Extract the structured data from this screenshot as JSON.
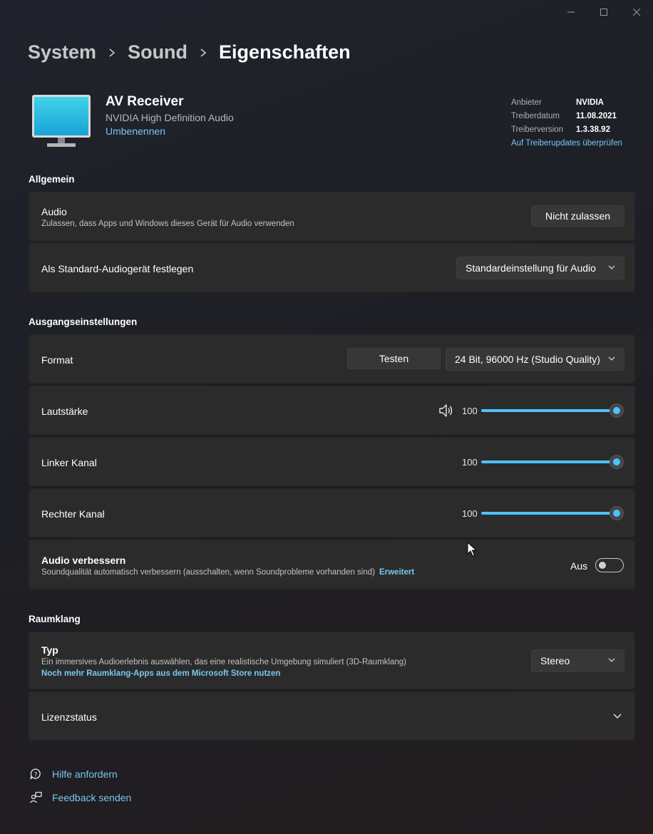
{
  "breadcrumb": {
    "items": [
      "System",
      "Sound"
    ],
    "current": "Eigenschaften"
  },
  "device": {
    "name": "AV Receiver",
    "description": "NVIDIA High Definition Audio",
    "rename_link": "Umbenennen",
    "icon": "monitor-icon"
  },
  "driver": {
    "provider_label": "Anbieter",
    "provider_value": "NVIDIA",
    "date_label": "Treiberdatum",
    "date_value": "11.08.2021",
    "version_label": "Treiberversion",
    "version_value": "1.3.38.92",
    "update_link": "Auf Treiberupdates überprüfen"
  },
  "sections": {
    "general": "Allgemein",
    "output": "Ausgangseinstellungen",
    "spatial": "Raumklang"
  },
  "audio": {
    "title": "Audio",
    "subtitle": "Zulassen, dass Apps und Windows dieses Gerät für Audio verwenden",
    "button": "Nicht zulassen"
  },
  "default_device": {
    "title": "Als Standard-Audiogerät festlegen",
    "dropdown": "Standardeinstellung für Audio"
  },
  "format": {
    "title": "Format",
    "test_button": "Testen",
    "dropdown": "24 Bit, 96000 Hz (Studio Quality)"
  },
  "volume": {
    "title": "Lautstärke",
    "value": "100",
    "level": 1.0,
    "icon": "speaker-icon"
  },
  "left_channel": {
    "title": "Linker Kanal",
    "value": "100",
    "level": 1.0
  },
  "right_channel": {
    "title": "Rechter Kanal",
    "value": "100",
    "level": 1.0
  },
  "enhance": {
    "title": "Audio verbessern",
    "subtitle": "Soundqualität automatisch verbessern (ausschalten, wenn Soundprobleme vorhanden sind)",
    "link": "Erweitert",
    "state_label": "Aus",
    "state": false
  },
  "spatial_type": {
    "title": "Typ",
    "subtitle": "Ein immersives Audioerlebnis auswählen, das eine realistische Umgebung simuliert (3D-Raumklang)",
    "link": "Noch mehr Raumklang-Apps aus dem Microsoft Store nutzen",
    "dropdown": "Stereo"
  },
  "license": {
    "title": "Lizenzstatus"
  },
  "footer": {
    "help": "Hilfe anfordern",
    "feedback": "Feedback senden"
  },
  "colors": {
    "accent": "#4cc2ff",
    "link": "#79c7ef",
    "card": "#2b2b2b"
  }
}
